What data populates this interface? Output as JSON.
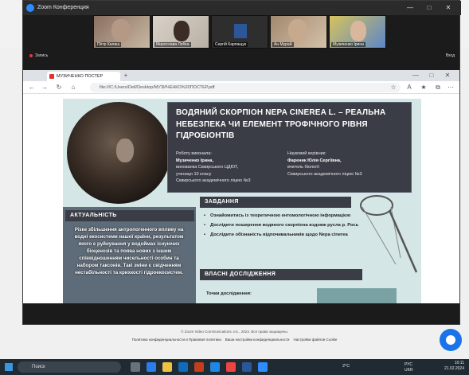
{
  "zoom": {
    "title": "Zoom Конференция",
    "record": "Запись",
    "exit": "Вход",
    "participants": [
      {
        "name": "Пётр Калиш"
      },
      {
        "name": "Мирослава Лобка"
      },
      {
        "name": "Сергій Карпащук"
      },
      {
        "name": "Ан Мурай"
      },
      {
        "name": "Музиченко Ірина"
      }
    ]
  },
  "browser": {
    "tab_title": "МУЗИЧЕНКО ПОСТЕР",
    "address": "file:///C:/Users/Dell/Desktop/МУЗИЧЕНКО%20ПОСТЕР.pdf"
  },
  "poster": {
    "title": "ВОДЯНИЙ СКОРПІОН NEPA CINEREA L. – РЕАЛЬНА НЕБЕЗПЕКА ЧИ ЕЛЕМЕНТ ТРОФІЧНОГО РІВНЯ ГІДРОБІОНТІВ",
    "author_label": "Роботу виконала:",
    "author_name": "Музиченко Ірина,",
    "author_line2": "вихованка Сквирського ЦДЮТ,",
    "author_line3": "учениця 10 класу",
    "author_line4": "Сквирського академічного ліцею №3",
    "advisor_label": "Науковий керівник:",
    "advisor_name": "Фареник Юлія Сергіївна,",
    "advisor_line2": "вчитель біології",
    "advisor_line3": "Сквирського академічного ліцею №3",
    "aktual_heading": "АКТУАЛЬНІСТЬ",
    "aktual_text": "Різке збільшення антропогенного впливу на водні екосистеми нашої країни, результатом якого є руйнування у водоймах існуючих біоценозів та поява нових з іншим співвідношенням чисельності особин та набором таксонів. Такі зміни є свідченням нестабільності та крихкості гідроекосистем.",
    "tasks_heading": "ЗАВДАННЯ",
    "tasks": [
      "Ознайомитись із теоретичною ентомологічною інформацією",
      "Дослідити поширення водяного скорпіона вздовж русла р. Рось",
      "Дослідити обізнаність відпочивальників щодо Nepa cinerea"
    ],
    "research_heading": "ВЛАСНІ ДОСЛІДЖЕННЯ",
    "points_label": "Точки дослідження:"
  },
  "footer": {
    "copyright": "© Zoom Video Communications, Inc., 2024. Все права защищены.",
    "privacy": "Политика конфиденциальности и Правовая политика",
    "privacy_settings": "Ваши настройки конфиденциальности",
    "cookie_settings": "Настройки файлов Cookie"
  },
  "taskbar": {
    "search": "Поиск",
    "weather": "2°C",
    "lang": "РУС",
    "lang2": "UKR",
    "time": "10:11",
    "date": "21.02.2024"
  }
}
